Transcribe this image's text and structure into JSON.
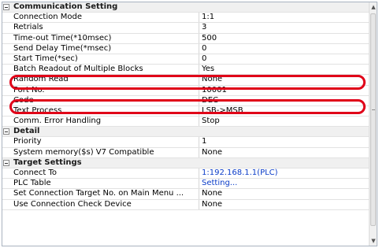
{
  "sections": [
    {
      "title": "Communication Setting",
      "rows": [
        {
          "name": "Connection Mode",
          "value": "1:1"
        },
        {
          "name": "Retrials",
          "value": "3"
        },
        {
          "name": "Time-out Time(*10msec)",
          "value": "500"
        },
        {
          "name": "Send Delay Time(*msec)",
          "value": "0"
        },
        {
          "name": "Start Time(*sec)",
          "value": "0"
        },
        {
          "name": "Batch Readout of Multiple Blocks",
          "value": "Yes"
        },
        {
          "name": "Random Read",
          "value": "None"
        },
        {
          "name": "Port No.",
          "value": "10001"
        },
        {
          "name": "Code",
          "value": "DEC"
        },
        {
          "name": "Text Process",
          "value": "LSB->MSB"
        },
        {
          "name": "Comm. Error Handling",
          "value": "Stop"
        }
      ]
    },
    {
      "title": "Detail",
      "rows": [
        {
          "name": "Priority",
          "value": "1"
        },
        {
          "name": "System memory($s) V7 Compatible",
          "value": "None"
        }
      ]
    },
    {
      "title": "Target Settings",
      "rows": [
        {
          "name": "Connect To",
          "value": "1:192.168.1.1(PLC)"
        },
        {
          "name": "PLC Table",
          "value": "Setting..."
        },
        {
          "name": "Set Connection Target No. on Main Menu ...",
          "value": "None"
        },
        {
          "name": "Use Connection Check Device",
          "value": "None"
        }
      ]
    }
  ],
  "colors": {
    "highlight": "#e00018",
    "link": "#0a3cc8",
    "section_bg": "#f0f0f0"
  },
  "icons": {
    "collapse": "minus-box-icon",
    "scroll_up": "triangle-up-icon",
    "scroll_down": "triangle-down-icon"
  }
}
